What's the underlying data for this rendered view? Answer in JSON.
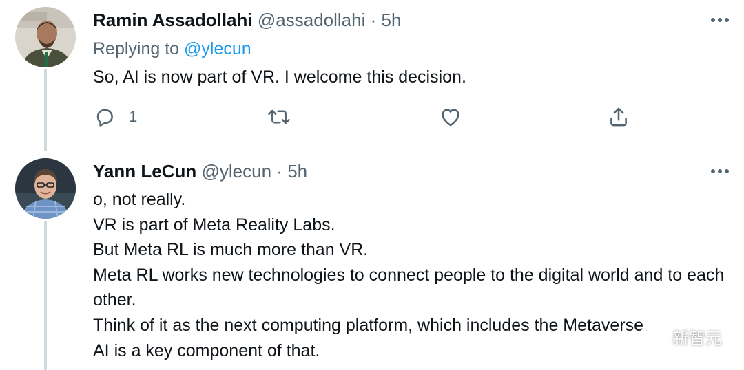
{
  "tweets": [
    {
      "author_name": "Ramin Assadollahi",
      "handle": "@assadollahi",
      "separator": "·",
      "time": "5h",
      "replying_prefix": "Replying to",
      "replying_to": "@ylecun",
      "text": "So, AI is now part of VR. I welcome this decision.",
      "reply_count": "1",
      "icons": [
        "reply-icon",
        "retweet-icon",
        "like-icon",
        "share-icon",
        "more-icon"
      ]
    },
    {
      "author_name": "Yann LeCun",
      "handle": "@ylecun",
      "separator": "·",
      "time": "5h",
      "text_lines": [
        "o, not really.",
        "VR is part of Meta Reality Labs.",
        "But Meta RL is much more than VR.",
        "Meta RL works new technologies to connect people to the digital world and to each other.",
        "Think of it as the next computing platform, which includes the Metaverse.",
        "AI is a key component of that."
      ],
      "icons": [
        "more-icon"
      ]
    }
  ],
  "watermark": {
    "text": "新智元",
    "icon": "wechat-logo-icon"
  },
  "colors": {
    "text": "#0f1419",
    "secondary": "#536471",
    "link": "#1d9bf0",
    "thread_line": "#cfd9de"
  }
}
